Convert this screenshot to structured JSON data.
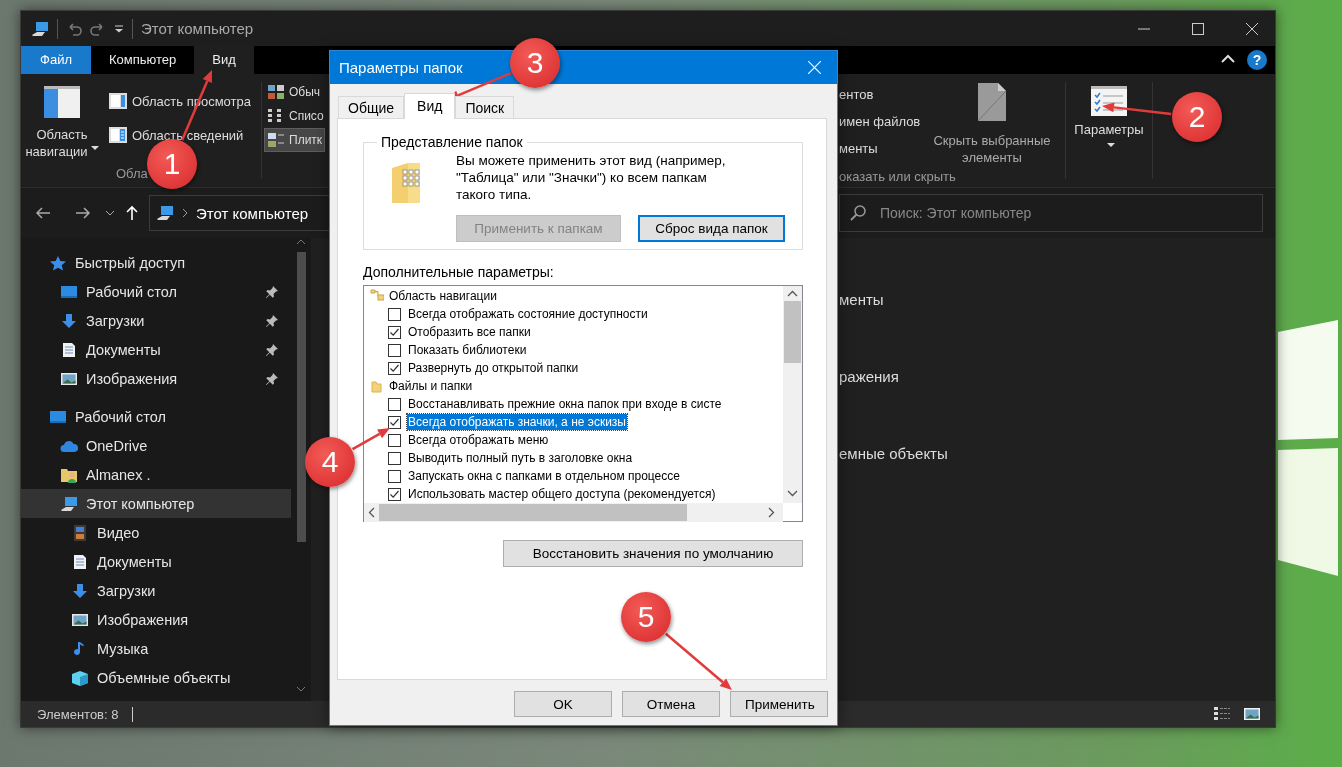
{
  "explorer": {
    "title": "Этот компьютер",
    "ribbon_tabs": [
      {
        "label": "Файл",
        "kind": "file",
        "selected": false
      },
      {
        "label": "Компьютер",
        "kind": "tab",
        "selected": false
      },
      {
        "label": "Вид",
        "kind": "tab",
        "selected": true
      }
    ],
    "help_button": "?",
    "ribbon": {
      "navigation_pane_button": "Область навигации",
      "pane_buttons": [
        {
          "label": "Область просмотра",
          "kind": "preview"
        },
        {
          "label": "Область сведений",
          "kind": "details"
        }
      ],
      "panes_group_label": "Обла",
      "layout_options": [
        {
          "label": "Обыч",
          "kind": "large-icons",
          "selected": false
        },
        {
          "label": "Списо",
          "kind": "list",
          "selected": false
        },
        {
          "label": "Плитк",
          "kind": "tiles",
          "selected": true
        }
      ],
      "show_hide_options": [
        "ентов",
        "имен файлов",
        "менты"
      ],
      "hide_selected_button": "Скрыть выбранные элементы",
      "show_hide_group_label": "оказать или скрыть",
      "options_button": "Параметры"
    },
    "address": "Этот компьютер",
    "search": {
      "placeholder": "Поиск: Этот компьютер"
    },
    "sidebar": [
      {
        "label": "Быстрый доступ",
        "kind": "star",
        "pinned": false,
        "selected": false,
        "children": [
          {
            "label": "Рабочий стол",
            "kind": "desktop",
            "pinned": true,
            "selected": false
          },
          {
            "label": "Загрузки",
            "kind": "download",
            "pinned": true,
            "selected": false
          },
          {
            "label": "Документы",
            "kind": "document",
            "pinned": true,
            "selected": false
          },
          {
            "label": "Изображения",
            "kind": "pictures",
            "pinned": true,
            "selected": false
          }
        ]
      },
      {
        "label": "Рабочий стол",
        "kind": "desktop",
        "pinned": false,
        "selected": false,
        "children": [
          {
            "label": "OneDrive",
            "kind": "cloud",
            "pinned": false,
            "selected": false
          },
          {
            "label": "Almanex .",
            "kind": "user",
            "pinned": false,
            "selected": false
          },
          {
            "label": "Этот компьютер",
            "kind": "computer",
            "pinned": false,
            "selected": true,
            "children": [
              {
                "label": "Видео",
                "kind": "video",
                "pinned": false,
                "selected": false
              },
              {
                "label": "Документы",
                "kind": "document",
                "pinned": false,
                "selected": false
              },
              {
                "label": "Загрузки",
                "kind": "download",
                "pinned": false,
                "selected": false
              },
              {
                "label": "Изображения",
                "kind": "pictures",
                "pinned": false,
                "selected": false
              },
              {
                "label": "Музыка",
                "kind": "music",
                "pinned": false,
                "selected": false
              },
              {
                "label": "Объемные объекты",
                "kind": "cube",
                "pinned": false,
                "selected": false
              }
            ]
          }
        ]
      }
    ],
    "content_items": [
      "менты",
      "ражения",
      "емные объекты"
    ],
    "status": {
      "item_count": "Элементов: 8"
    }
  },
  "dialog": {
    "title": "Параметры папок",
    "tabs": [
      {
        "label": "Общие",
        "selected": false
      },
      {
        "label": "Вид",
        "selected": true
      },
      {
        "label": "Поиск",
        "selected": false
      }
    ],
    "folder_views": {
      "legend": "Представление папок",
      "description": "Вы можете применить этот вид (например, \"Таблица\" или \"Значки\") ко всем папкам такого типа.",
      "buttons": [
        {
          "label": "Применить к папкам",
          "disabled": true,
          "focused": false
        },
        {
          "label": "Сброс вида папок",
          "disabled": false,
          "focused": true
        }
      ]
    },
    "advanced_label": "Дополнительные параметры:",
    "advanced_settings": [
      {
        "label": "Область навигации",
        "kind": "tree-group",
        "children": [
          {
            "label": "Всегда отображать состояние доступности",
            "checked": false,
            "selected": false
          },
          {
            "label": "Отобразить все папки",
            "checked": true,
            "selected": false
          },
          {
            "label": "Показать библиотеки",
            "checked": false,
            "selected": false
          },
          {
            "label": "Развернуть до открытой папки",
            "checked": true,
            "selected": false
          }
        ]
      },
      {
        "label": "Файлы и папки",
        "kind": "folder-group",
        "children": [
          {
            "label": "Восстанавливать прежние окна папок при входе в систе",
            "checked": false,
            "selected": false
          },
          {
            "label": "Всегда отображать значки, а не эскизы",
            "checked": true,
            "selected": true
          },
          {
            "label": "Всегда отображать меню",
            "checked": false,
            "selected": false
          },
          {
            "label": "Выводить полный путь в заголовке окна",
            "checked": false,
            "selected": false
          },
          {
            "label": "Запускать окна с папками в отдельном процессе",
            "checked": false,
            "selected": false
          },
          {
            "label": "Использовать мастер общего доступа (рекомендуется)",
            "checked": true,
            "selected": false
          }
        ]
      }
    ],
    "restore_defaults_button": "Восстановить значения по умолчанию",
    "buttons": [
      "OK",
      "Отмена",
      "Применить"
    ]
  },
  "annotations": [
    {
      "number": "1"
    },
    {
      "number": "2"
    },
    {
      "number": "3"
    },
    {
      "number": "4"
    },
    {
      "number": "5"
    }
  ]
}
